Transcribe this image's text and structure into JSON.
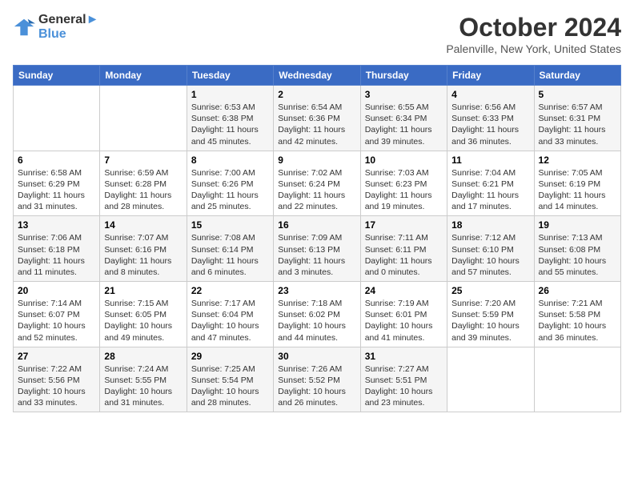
{
  "header": {
    "logo_line1": "General",
    "logo_line2": "Blue",
    "month": "October 2024",
    "location": "Palenville, New York, United States"
  },
  "days_of_week": [
    "Sunday",
    "Monday",
    "Tuesday",
    "Wednesday",
    "Thursday",
    "Friday",
    "Saturday"
  ],
  "weeks": [
    [
      {
        "day": "",
        "info": ""
      },
      {
        "day": "",
        "info": ""
      },
      {
        "day": "1",
        "info": "Sunrise: 6:53 AM\nSunset: 6:38 PM\nDaylight: 11 hours and 45 minutes."
      },
      {
        "day": "2",
        "info": "Sunrise: 6:54 AM\nSunset: 6:36 PM\nDaylight: 11 hours and 42 minutes."
      },
      {
        "day": "3",
        "info": "Sunrise: 6:55 AM\nSunset: 6:34 PM\nDaylight: 11 hours and 39 minutes."
      },
      {
        "day": "4",
        "info": "Sunrise: 6:56 AM\nSunset: 6:33 PM\nDaylight: 11 hours and 36 minutes."
      },
      {
        "day": "5",
        "info": "Sunrise: 6:57 AM\nSunset: 6:31 PM\nDaylight: 11 hours and 33 minutes."
      }
    ],
    [
      {
        "day": "6",
        "info": "Sunrise: 6:58 AM\nSunset: 6:29 PM\nDaylight: 11 hours and 31 minutes."
      },
      {
        "day": "7",
        "info": "Sunrise: 6:59 AM\nSunset: 6:28 PM\nDaylight: 11 hours and 28 minutes."
      },
      {
        "day": "8",
        "info": "Sunrise: 7:00 AM\nSunset: 6:26 PM\nDaylight: 11 hours and 25 minutes."
      },
      {
        "day": "9",
        "info": "Sunrise: 7:02 AM\nSunset: 6:24 PM\nDaylight: 11 hours and 22 minutes."
      },
      {
        "day": "10",
        "info": "Sunrise: 7:03 AM\nSunset: 6:23 PM\nDaylight: 11 hours and 19 minutes."
      },
      {
        "day": "11",
        "info": "Sunrise: 7:04 AM\nSunset: 6:21 PM\nDaylight: 11 hours and 17 minutes."
      },
      {
        "day": "12",
        "info": "Sunrise: 7:05 AM\nSunset: 6:19 PM\nDaylight: 11 hours and 14 minutes."
      }
    ],
    [
      {
        "day": "13",
        "info": "Sunrise: 7:06 AM\nSunset: 6:18 PM\nDaylight: 11 hours and 11 minutes."
      },
      {
        "day": "14",
        "info": "Sunrise: 7:07 AM\nSunset: 6:16 PM\nDaylight: 11 hours and 8 minutes."
      },
      {
        "day": "15",
        "info": "Sunrise: 7:08 AM\nSunset: 6:14 PM\nDaylight: 11 hours and 6 minutes."
      },
      {
        "day": "16",
        "info": "Sunrise: 7:09 AM\nSunset: 6:13 PM\nDaylight: 11 hours and 3 minutes."
      },
      {
        "day": "17",
        "info": "Sunrise: 7:11 AM\nSunset: 6:11 PM\nDaylight: 11 hours and 0 minutes."
      },
      {
        "day": "18",
        "info": "Sunrise: 7:12 AM\nSunset: 6:10 PM\nDaylight: 10 hours and 57 minutes."
      },
      {
        "day": "19",
        "info": "Sunrise: 7:13 AM\nSunset: 6:08 PM\nDaylight: 10 hours and 55 minutes."
      }
    ],
    [
      {
        "day": "20",
        "info": "Sunrise: 7:14 AM\nSunset: 6:07 PM\nDaylight: 10 hours and 52 minutes."
      },
      {
        "day": "21",
        "info": "Sunrise: 7:15 AM\nSunset: 6:05 PM\nDaylight: 10 hours and 49 minutes."
      },
      {
        "day": "22",
        "info": "Sunrise: 7:17 AM\nSunset: 6:04 PM\nDaylight: 10 hours and 47 minutes."
      },
      {
        "day": "23",
        "info": "Sunrise: 7:18 AM\nSunset: 6:02 PM\nDaylight: 10 hours and 44 minutes."
      },
      {
        "day": "24",
        "info": "Sunrise: 7:19 AM\nSunset: 6:01 PM\nDaylight: 10 hours and 41 minutes."
      },
      {
        "day": "25",
        "info": "Sunrise: 7:20 AM\nSunset: 5:59 PM\nDaylight: 10 hours and 39 minutes."
      },
      {
        "day": "26",
        "info": "Sunrise: 7:21 AM\nSunset: 5:58 PM\nDaylight: 10 hours and 36 minutes."
      }
    ],
    [
      {
        "day": "27",
        "info": "Sunrise: 7:22 AM\nSunset: 5:56 PM\nDaylight: 10 hours and 33 minutes."
      },
      {
        "day": "28",
        "info": "Sunrise: 7:24 AM\nSunset: 5:55 PM\nDaylight: 10 hours and 31 minutes."
      },
      {
        "day": "29",
        "info": "Sunrise: 7:25 AM\nSunset: 5:54 PM\nDaylight: 10 hours and 28 minutes."
      },
      {
        "day": "30",
        "info": "Sunrise: 7:26 AM\nSunset: 5:52 PM\nDaylight: 10 hours and 26 minutes."
      },
      {
        "day": "31",
        "info": "Sunrise: 7:27 AM\nSunset: 5:51 PM\nDaylight: 10 hours and 23 minutes."
      },
      {
        "day": "",
        "info": ""
      },
      {
        "day": "",
        "info": ""
      }
    ]
  ]
}
